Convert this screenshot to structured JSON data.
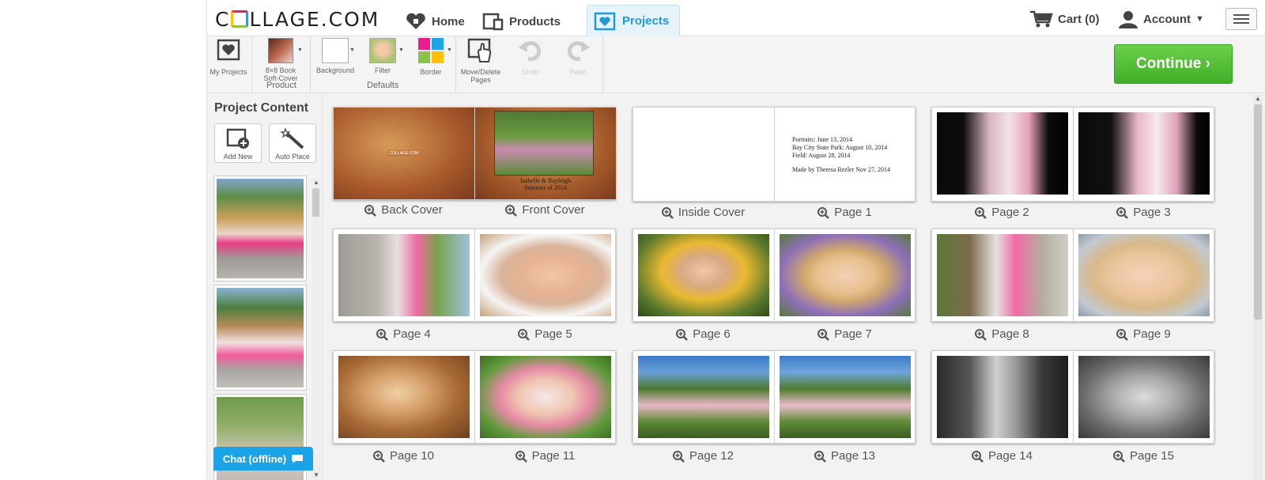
{
  "topnav": {
    "home": "Home",
    "products": "Products",
    "projects": "Projects",
    "cart": "Cart (0)",
    "account": "Account"
  },
  "toolbar": {
    "my_projects": "My Projects",
    "product_line1": "8×8 Book",
    "product_line2": "Soft-Cover",
    "product_label": "Product",
    "background": "Background",
    "filter": "Filter",
    "border": "Border",
    "defaults_label": "Defaults",
    "move_delete_line1": "Move/Delete",
    "move_delete_line2": "Pages",
    "undo": "Undo",
    "redo": "Redo",
    "continue": "Continue ›"
  },
  "left_panel": {
    "title": "Project Content",
    "add_new": "Add New",
    "auto_place": "Auto Place",
    "chat": "Chat (offline)"
  },
  "cover_text": {
    "back_logo": "COLLAGE.COM",
    "front_line1": "Isabelle & Rayleigh",
    "front_line2": "Summer of 2014"
  },
  "inside_cover_text": [
    "Portraits:  June 13, 2014",
    "Bay City State Park:  August 10, 2014",
    "Field:  August 28, 2014",
    "",
    "Made by Theresa Rezler Nov 27, 2014"
  ],
  "spreads": [
    {
      "left": "Back Cover",
      "right": "Front Cover"
    },
    {
      "left": "Inside Cover",
      "right": "Page 1"
    },
    {
      "left": "Page 2",
      "right": "Page 3"
    },
    {
      "left": "Page 4",
      "right": "Page 5"
    },
    {
      "left": "Page 6",
      "right": "Page 7"
    },
    {
      "left": "Page 8",
      "right": "Page 9"
    },
    {
      "left": "Page 10",
      "right": "Page 11"
    },
    {
      "left": "Page 12",
      "right": "Page 13"
    },
    {
      "left": "Page 14",
      "right": "Page 15"
    }
  ],
  "colors": {
    "accent": "#1f9ad6",
    "continue_green": "#4cbf30",
    "chat_blue": "#1aa3e6"
  }
}
